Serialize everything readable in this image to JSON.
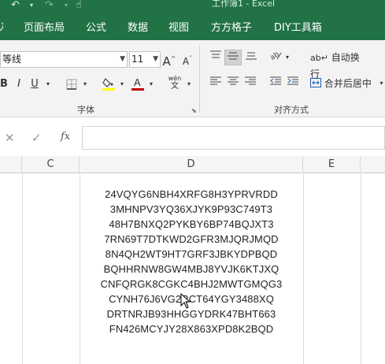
{
  "titlebar": {
    "title": "工作簿1 - Excel",
    "icons": [
      "undo-icon",
      "undo-dropdown-icon",
      "redo-icon",
      "redo-dropdown-icon",
      "touch-mode-icon"
    ]
  },
  "menu": {
    "items": [
      "页面布局",
      "公式",
      "数据",
      "视图",
      "方方格子",
      "DIY工具箱"
    ]
  },
  "ribbon": {
    "font_name": "等线",
    "font_size": "11",
    "bold": "B",
    "italic": "I",
    "underline": "U",
    "phonetic": "wén",
    "wrap_text": "自动换行",
    "merge_center": "合并后居中",
    "group_font": "字体",
    "group_alignment": "对齐方式",
    "font_color": "#c00000",
    "fill_color": "#ffff00"
  },
  "formula_bar": {
    "cancel": "✕",
    "enter": "✓",
    "fx": "fx",
    "value": ""
  },
  "columns": [
    "C",
    "D",
    "E"
  ],
  "cells": [
    "24VQYG6NBH4XRFG8H3YPRVRDD",
    "3MHNPV3YQ36XJYK9P93C749T3",
    "48H7BNXQ2PYKBY6BP74BQJXT3",
    "7RN69T7DTKWD2GFR3MJQRJMQD",
    "8N4QH2WT9HT7GRF3JBKYDPBQD",
    "BQHHRNW8GW4MBJ8YVJK6KTJXQ",
    "CNFQRGK8CGKC4BHJ2MWTGMQG3",
    "CYNH76J6VG2RCT64YGY3488XQ",
    "DRTNRJB93HHGGYDRK47BHT663",
    "FN426MCYJY28X863XPD8K2BQD"
  ]
}
